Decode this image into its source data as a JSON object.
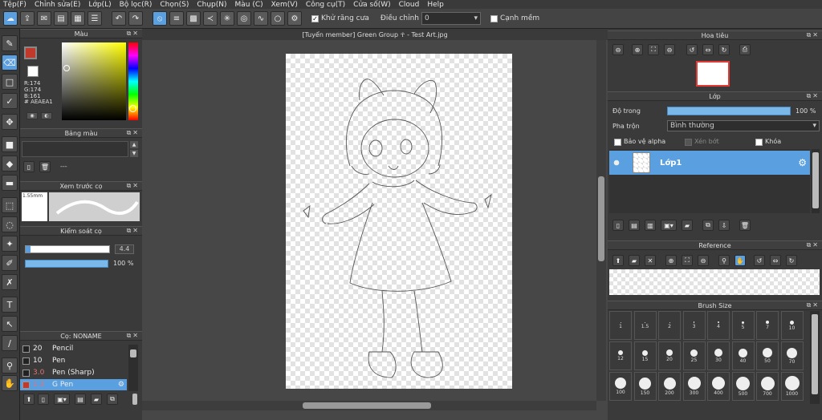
{
  "menu": [
    "Tệp(F)",
    "Chỉnh sửa(E)",
    "Lớp(L)",
    "Bộ lọc(R)",
    "Chọn(S)",
    "Chụp(N)",
    "Màu (C)",
    "Xem(V)",
    "Công cụ(T)",
    "Cửa số(W)",
    "Cloud",
    "Help"
  ],
  "toolbar": {
    "antialias_label": "Khử răng cưa",
    "adjust_label": "Điều chỉnh",
    "adjust_value": "0",
    "smooth_label": "Cạnh mềm"
  },
  "color_panel": {
    "title": "Màu",
    "r": "R:174",
    "g": "G:174",
    "b": "B:161",
    "hex": "# AEAEA1"
  },
  "palette_panel": {
    "title": "Bảng màu",
    "more": "---"
  },
  "preview_panel": {
    "title": "Xem trước cọ",
    "size": "1.55mm"
  },
  "brush_control": {
    "title": "Kiểm soát cọ",
    "size_value": "4.4",
    "opacity_value": "100 %"
  },
  "brush_panel": {
    "title": "Cọ: NONAME",
    "items": [
      {
        "size": "20",
        "name": "Pencil"
      },
      {
        "size": "10",
        "name": "Pen"
      },
      {
        "size": "3.0",
        "name": "Pen (Sharp)"
      },
      {
        "size": "1.3",
        "name": "G Pen"
      }
    ]
  },
  "canvas": {
    "tab_title": "[Tuyển member] Green Group ☥ - Test Art.jpg"
  },
  "navigator": {
    "title": "Hoa tiêu"
  },
  "layer_panel": {
    "title": "Lớp",
    "opacity_label": "Độ trong",
    "opacity_value": "100 %",
    "opacity_fraction": 1.0,
    "blend_label": "Pha trộn",
    "blend_value": "Bình thường",
    "protect_alpha": "Bảo vệ alpha",
    "clip": "Xén bớt",
    "lock": "Khóa",
    "layer_name": "Lớp1"
  },
  "reference": {
    "title": "Reference"
  },
  "brush_size": {
    "title": "Brush Size",
    "sizes": [
      "1",
      "1.5",
      "2",
      "3",
      "4",
      "5",
      "7",
      "10",
      "12",
      "15",
      "20",
      "25",
      "30",
      "40",
      "50",
      "70",
      "100",
      "150",
      "200",
      "300",
      "400",
      "500",
      "700",
      "1000"
    ]
  },
  "colors": {
    "accent": "#5aa0e0",
    "main_color": "#c0392b"
  }
}
